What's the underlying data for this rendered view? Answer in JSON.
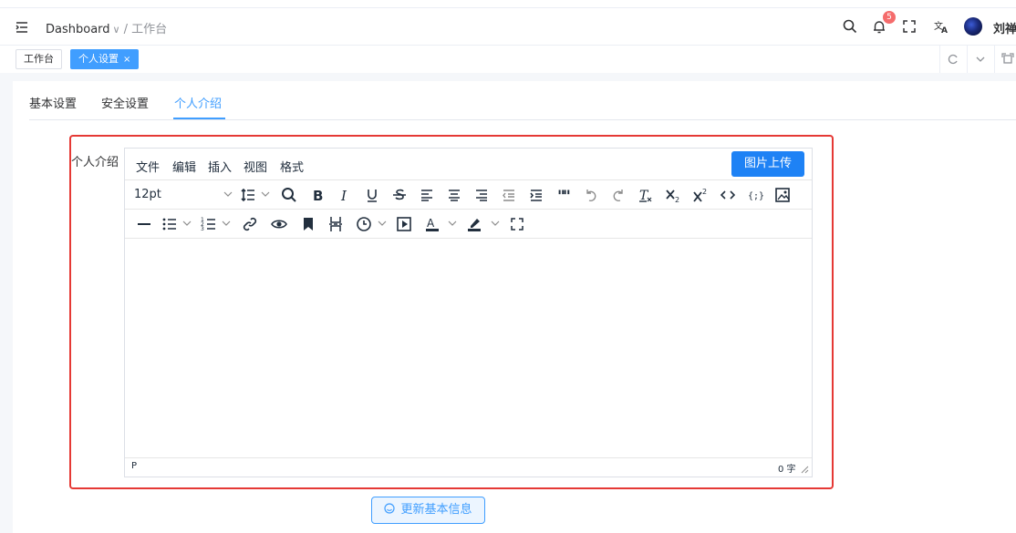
{
  "header": {
    "breadcrumb_root": "Dashboard",
    "breadcrumb_sep": "/",
    "breadcrumb_current": "工作台",
    "notification_count": "5",
    "user_name": "刘禅"
  },
  "tabs": [
    {
      "label": "工作台"
    },
    {
      "label": "个人设置",
      "close": "×"
    }
  ],
  "settings_tabs": [
    {
      "label": "基本设置"
    },
    {
      "label": "安全设置"
    },
    {
      "label": "个人介绍"
    }
  ],
  "form": {
    "field_label": "个人介绍"
  },
  "editor": {
    "menus": [
      "文件",
      "编辑",
      "插入",
      "视图",
      "格式"
    ],
    "upload_label": "图片上传",
    "font_size": "12pt",
    "status_path": "P",
    "word_count": "0 字"
  },
  "save_button": {
    "label": "更新基本信息"
  },
  "colors": {
    "accent": "#409eff",
    "upload_button": "#1e82f5",
    "highlight_border": "#e53935",
    "badge": "#f56c6c"
  },
  "icons": [
    "hamburger-icon",
    "search-icon",
    "bell-icon",
    "fullscreen-icon",
    "translate-icon",
    "refresh-icon",
    "chevron-down-icon",
    "maximize-icon",
    "smile-icon"
  ]
}
